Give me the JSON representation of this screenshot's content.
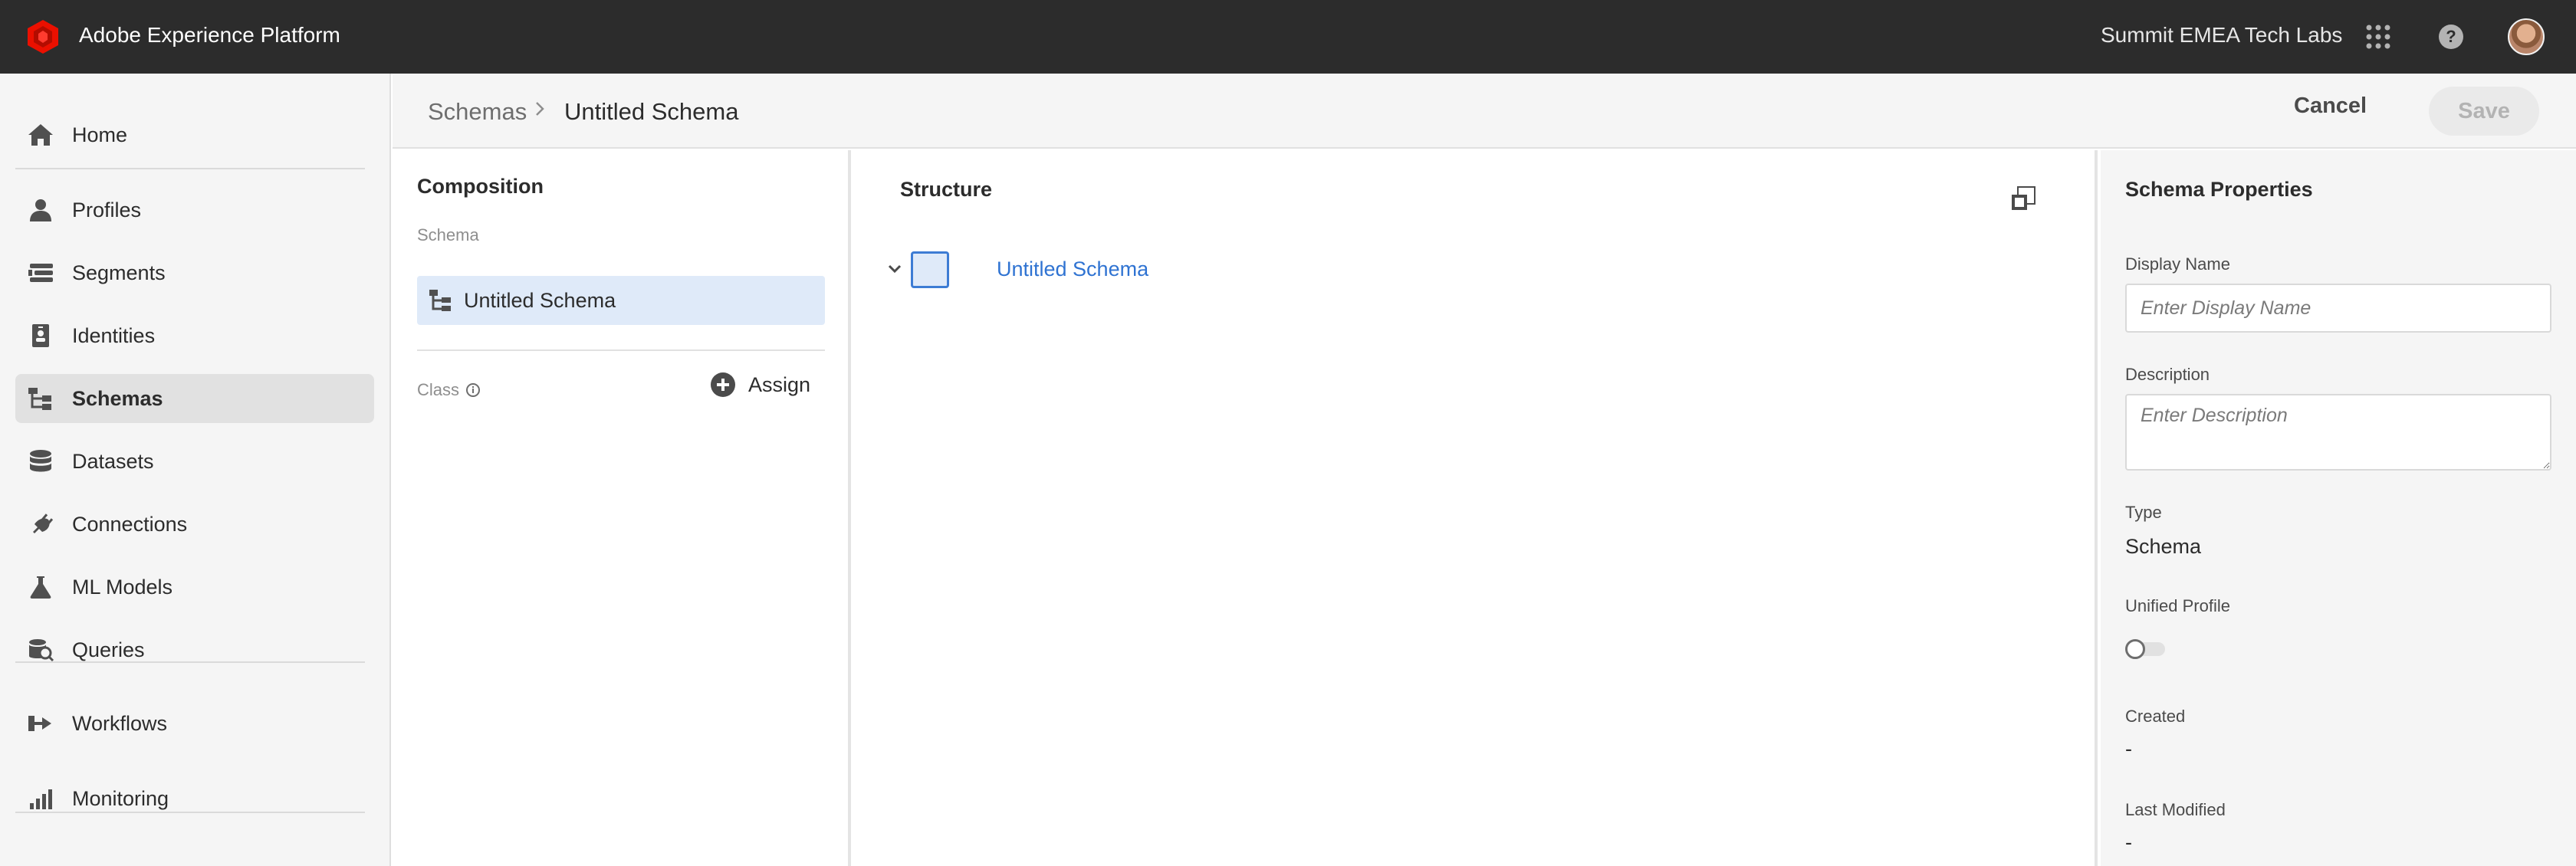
{
  "app": {
    "title": "Adobe Experience Platform",
    "org": "Summit EMEA Tech Labs",
    "icons": {
      "logo": "adobe-logo-icon",
      "apps": "apps-grid-icon",
      "help": "help-icon",
      "avatar": "user-avatar"
    },
    "brand_color": "#eb1000"
  },
  "nav": {
    "items": [
      {
        "label": "Home",
        "icon": "home-icon"
      },
      {
        "label": "Profiles",
        "icon": "person-icon"
      },
      {
        "label": "Segments",
        "icon": "segments-icon"
      },
      {
        "label": "Identities",
        "icon": "identity-card-icon"
      },
      {
        "label": "Schemas",
        "icon": "schema-tree-icon",
        "active": true
      },
      {
        "label": "Datasets",
        "icon": "database-icon"
      },
      {
        "label": "Connections",
        "icon": "plug-icon"
      },
      {
        "label": "ML Models",
        "icon": "flask-icon"
      },
      {
        "label": "Queries",
        "icon": "query-icon"
      },
      {
        "label": "Workflows",
        "icon": "workflow-icon"
      },
      {
        "label": "Monitoring",
        "icon": "bar-chart-icon"
      }
    ]
  },
  "header": {
    "breadcrumb": [
      "Schemas",
      "Untitled Schema"
    ],
    "cancel_label": "Cancel",
    "save_label": "Save"
  },
  "composition": {
    "title": "Composition",
    "schema_section": "Schema",
    "schema_item": "Untitled Schema",
    "class_label": "Class",
    "assign_label": "Assign"
  },
  "structure": {
    "title": "Structure",
    "root_label": "Untitled Schema"
  },
  "properties": {
    "title": "Schema Properties",
    "display_name_label": "Display Name",
    "display_name_placeholder": "Enter Display Name",
    "description_label": "Description",
    "description_placeholder": "Enter Description",
    "type_label": "Type",
    "type_value": "Schema",
    "unified_profile_label": "Unified Profile",
    "unified_profile_enabled": false,
    "created_label": "Created",
    "created_value": "-",
    "last_modified_label": "Last Modified",
    "last_modified_value": "-"
  }
}
